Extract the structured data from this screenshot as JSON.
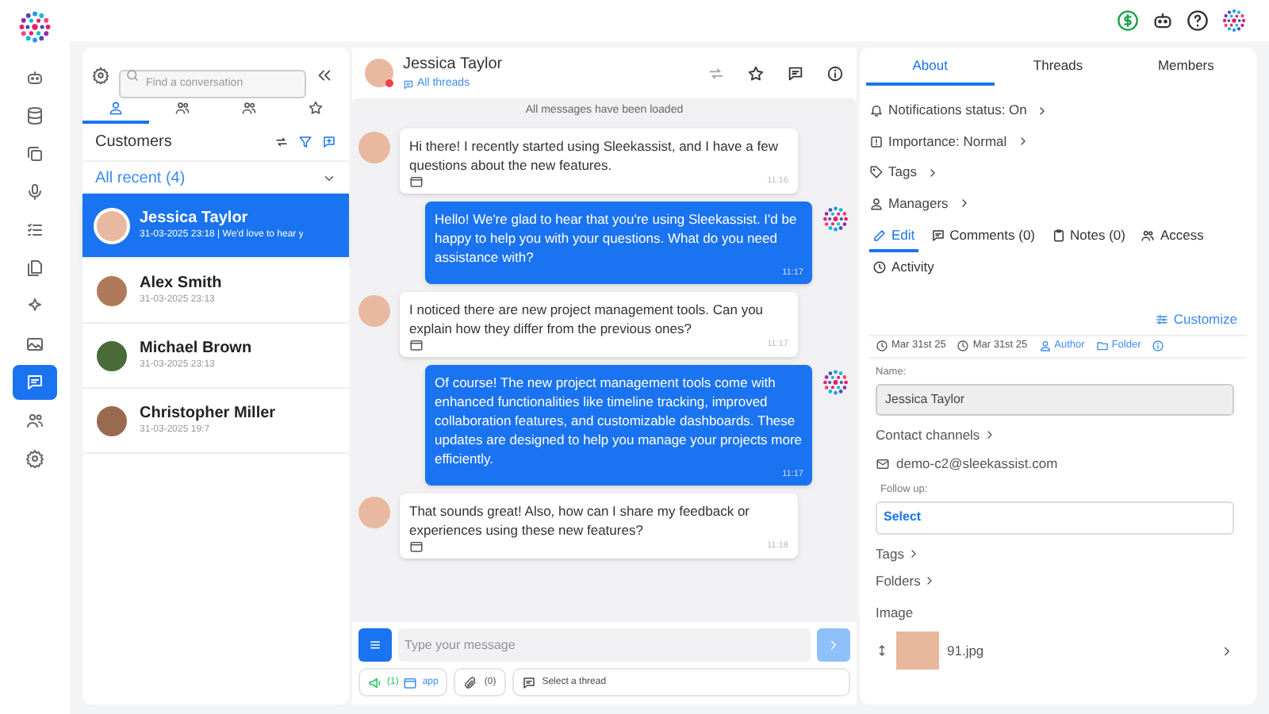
{
  "rail": [
    {
      "selected": false
    },
    {
      "selected": false
    },
    {
      "selected": false
    },
    {
      "selected": false
    },
    {
      "selected": false
    },
    {
      "selected": false
    },
    {
      "selected": false
    },
    {
      "selected": false
    },
    {
      "selected": true
    },
    {
      "selected": false
    },
    {
      "selected": false
    }
  ],
  "conversations": {
    "search": {
      "placeholder": "Find a conversation"
    },
    "tabs": [
      {
        "kind": "person",
        "selected": true
      },
      {
        "kind": "group",
        "selected": false
      },
      {
        "kind": "team",
        "selected": false
      },
      {
        "kind": "star",
        "selected": false
      }
    ],
    "section": "Customers",
    "filter": "All recent (4)",
    "items": [
      {
        "name": "Jessica Taylor",
        "meta": "31-03-2025 23:18 | We'd love to hear y",
        "selected": true
      },
      {
        "name": "Alex Smith",
        "meta": "31-03-2025 23:13",
        "selected": false
      },
      {
        "name": "Michael Brown",
        "meta": "31-03-2025 23:13",
        "selected": false
      },
      {
        "name": "Christopher Miller",
        "meta": "31-03-2025 19:7",
        "selected": false
      }
    ]
  },
  "chat": {
    "name": "Jessica Taylor",
    "threads_link": "All threads",
    "notice": "All messages have been loaded",
    "messages": [
      {
        "kind": "customer",
        "text": "Hi there! I recently started using Sleekassist, and I have a few questions about the new features.",
        "time": "11:16"
      },
      {
        "kind": "agent",
        "text": "Hello! We're glad to hear that you're using Sleekassist. I'd be happy to help you with your questions. What do you need assistance with?",
        "time": "11:17"
      },
      {
        "kind": "customer",
        "text": "I noticed there are new project management tools. Can you explain how they differ from the previous ones?",
        "time": "11:17"
      },
      {
        "kind": "agent",
        "text": "Of course! The new project management tools come with enhanced functionalities like timeline tracking, improved collaboration features, and customizable dashboards. These updates are designed to help you manage your projects more efficiently.",
        "time": "11:17"
      },
      {
        "kind": "customer",
        "text": "That sounds great! Also, how can I share my feedback or experiences using these new features?",
        "time": "11:18"
      }
    ],
    "composer": {
      "placeholder": "Type your message"
    },
    "channel_count": "(1)",
    "channel_label": "app",
    "attachments": "(0)",
    "thread_select": "Select a thread"
  },
  "details": {
    "tabs": [
      {
        "label": "About",
        "selected": true
      },
      {
        "label": "Threads",
        "selected": false
      },
      {
        "label": "Members",
        "selected": false
      }
    ],
    "properties": [
      {
        "kind": "bell",
        "label": "Notifications status: On"
      },
      {
        "kind": "flag",
        "label": "Importance: Normal"
      },
      {
        "kind": "tag",
        "label": "Tags"
      },
      {
        "kind": "user",
        "label": "Managers"
      }
    ],
    "subtabs": [
      {
        "kind": "edit",
        "label": "Edit",
        "selected": true
      },
      {
        "kind": "comments",
        "label": "Comments (0)",
        "selected": false
      },
      {
        "kind": "notes",
        "label": "Notes (0)",
        "selected": false
      },
      {
        "kind": "access",
        "label": "Access",
        "selected": false
      },
      {
        "kind": "activity",
        "label": "Activity",
        "selected": false
      }
    ],
    "customize": "Customize",
    "created": "Mar 31st 25",
    "updated": "Mar 31st 25",
    "author": "Author",
    "folder": "Folder",
    "name_label": "Name:",
    "name_value": "Jessica Taylor",
    "contact_channels": "Contact channels",
    "email": "demo-c2@sleekassist.com",
    "follow_up_label": "Follow up:",
    "follow_up_value": "Select",
    "tags": "Tags",
    "folders": "Folders",
    "image_label": "Image",
    "image_file": "91.jpg"
  }
}
